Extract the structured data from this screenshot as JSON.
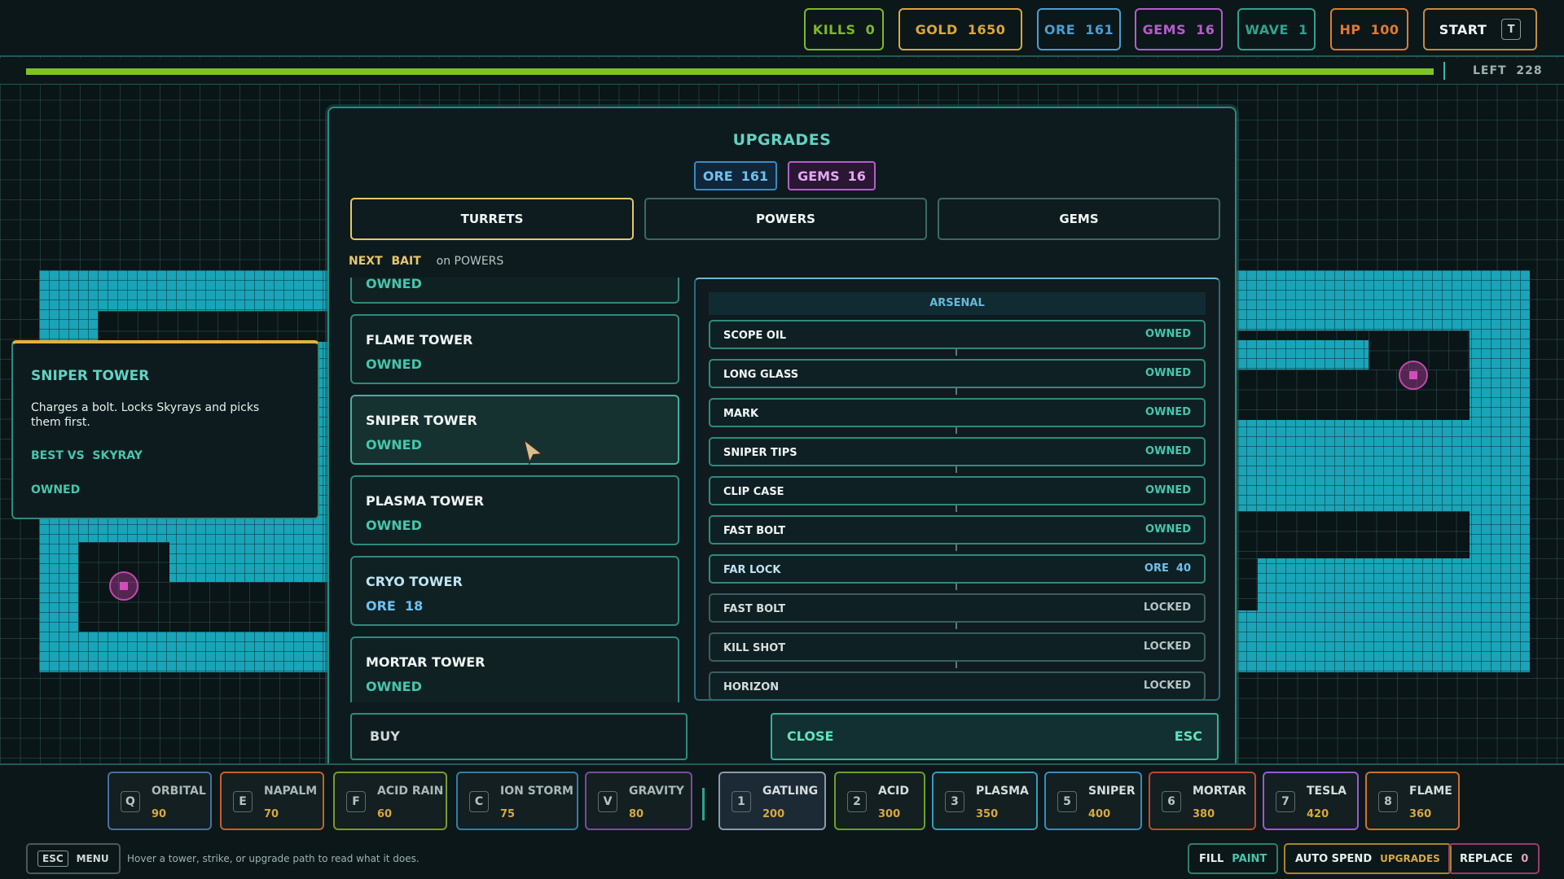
{
  "header": {
    "stats": [
      {
        "label": "KILLS",
        "value": "0",
        "color": "#7fb828"
      },
      {
        "label": "GOLD",
        "value": "1650",
        "color": "#d9a83e"
      },
      {
        "label": "ORE",
        "value": "161",
        "color": "#4a9ed0"
      },
      {
        "label": "GEMS",
        "value": "16",
        "color": "#b25fc9"
      },
      {
        "label": "WAVE",
        "value": "1",
        "color": "#2fa38f"
      },
      {
        "label": "HP",
        "value": "100",
        "color": "#e07a30"
      }
    ],
    "start_label": "START",
    "start_key": "T",
    "left_label": "LEFT",
    "left_value": "228",
    "progress": 1.0
  },
  "modal": {
    "title": "UPGRADES",
    "ore_label": "ORE",
    "ore_value": "161",
    "gems_label": "GEMS",
    "gems_value": "16",
    "tabs": [
      "TURRETS",
      "POWERS",
      "GEMS"
    ],
    "next_label": "NEXT",
    "bait_label": "BAIT",
    "bait_on": "on POWERS",
    "turrets": [
      {
        "name": "",
        "status": "OWNED"
      },
      {
        "name": "FLAME TOWER",
        "status": "OWNED"
      },
      {
        "name": "SNIPER TOWER",
        "status": "OWNED"
      },
      {
        "name": "PLASMA TOWER",
        "status": "OWNED"
      },
      {
        "name": "CRYO TOWER",
        "status": "ORE  18"
      },
      {
        "name": "MORTAR TOWER",
        "status": "OWNED"
      }
    ],
    "arsenal_title": "ARSENAL",
    "arsenal": [
      {
        "name": "SCOPE OIL",
        "status": "OWNED"
      },
      {
        "name": "LONG GLASS",
        "status": "OWNED"
      },
      {
        "name": "MARK",
        "status": "OWNED"
      },
      {
        "name": "SNIPER TIPS",
        "status": "OWNED"
      },
      {
        "name": "CLIP CASE",
        "status": "OWNED"
      },
      {
        "name": "FAST BOLT",
        "status": "OWNED"
      },
      {
        "name": "FAR LOCK",
        "status": "ORE  40"
      },
      {
        "name": "FAST BOLT",
        "status": "LOCKED"
      },
      {
        "name": "KILL SHOT",
        "status": "LOCKED"
      },
      {
        "name": "HORIZON",
        "status": "LOCKED"
      }
    ],
    "buy_label": "BUY",
    "close_label": "CLOSE",
    "close_key": "ESC"
  },
  "tooltip": {
    "title": "SNIPER TOWER",
    "desc": "Charges a bolt. Locks Skyrays and picks them first.",
    "best_label": "BEST VS",
    "best_value": "SKYRAY",
    "status": "OWNED"
  },
  "abilities": [
    {
      "key": "Q",
      "name": "ORBITAL",
      "cost": "90",
      "color": "#4a6fa0"
    },
    {
      "key": "E",
      "name": "NAPALM",
      "cost": "70",
      "color": "#c0622f"
    },
    {
      "key": "F",
      "name": "ACID RAIN",
      "cost": "60",
      "color": "#7a9a2a"
    },
    {
      "key": "C",
      "name": "ION STORM",
      "cost": "75",
      "color": "#2f7fa8"
    },
    {
      "key": "V",
      "name": "GRAVITY",
      "cost": "80",
      "color": "#7a4aa0"
    }
  ],
  "towers": [
    {
      "key": "1",
      "name": "GATLING",
      "cost": "200",
      "color": "#8a9aa8"
    },
    {
      "key": "2",
      "name": "ACID",
      "cost": "300",
      "color": "#6aa02a"
    },
    {
      "key": "3",
      "name": "PLASMA",
      "cost": "350",
      "color": "#2fa0b8"
    },
    {
      "key": "5",
      "name": "SNIPER",
      "cost": "400",
      "color": "#3a8ac0"
    },
    {
      "key": "6",
      "name": "MORTAR",
      "cost": "380",
      "color": "#c04a2a"
    },
    {
      "key": "7",
      "name": "TESLA",
      "cost": "420",
      "color": "#9a5ad0"
    },
    {
      "key": "8",
      "name": "FLAME",
      "cost": "360",
      "color": "#d0702a"
    }
  ],
  "footer": {
    "menu_key": "ESC",
    "menu_label": "MENU",
    "hint": "Hover a tower, strike, or upgrade path to read what it does.",
    "fill_label": "FILL",
    "fill_value": "PAINT",
    "auto_label": "AUTO SPEND",
    "auto_value": "UPGRADES",
    "replace_label": "REPLACE",
    "replace_value": "0"
  }
}
